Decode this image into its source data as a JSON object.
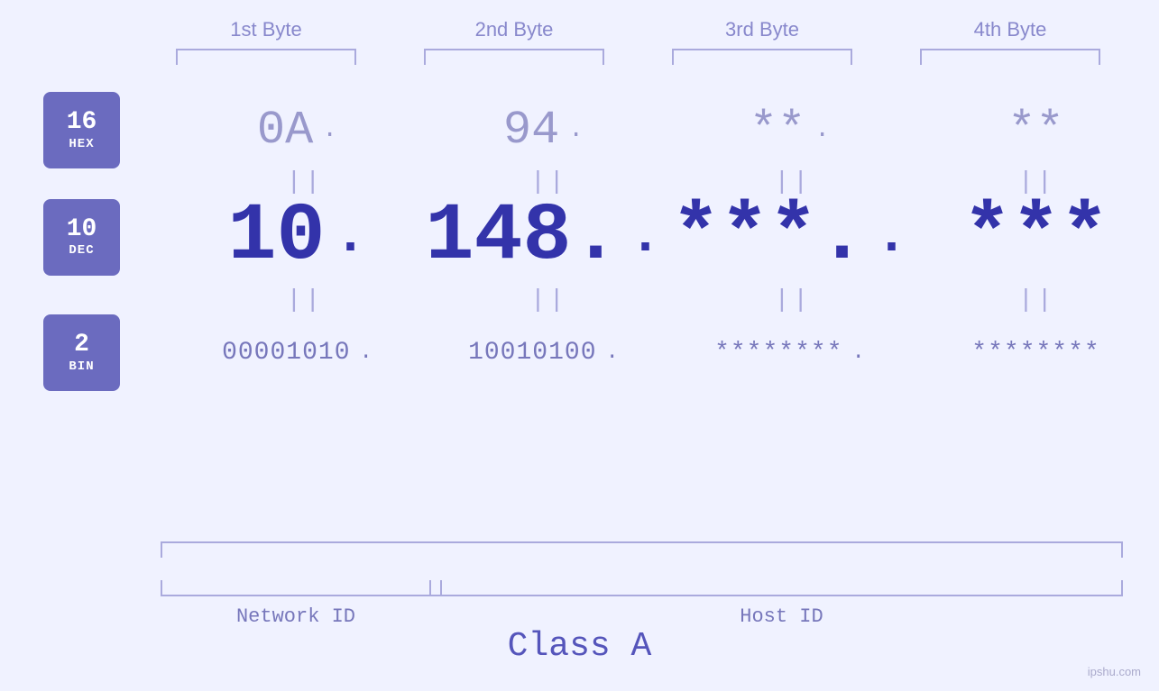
{
  "page": {
    "background": "#f0f2ff",
    "watermark": "ipshu.com"
  },
  "byteHeaders": [
    "1st Byte",
    "2nd Byte",
    "3rd Byte",
    "4th Byte"
  ],
  "rows": {
    "hex": {
      "badge": {
        "number": "16",
        "label": "HEX"
      },
      "values": [
        "0A",
        "94",
        "**",
        "**"
      ],
      "dots": [
        ".",
        ".",
        ".",
        ""
      ]
    },
    "dec": {
      "badge": {
        "number": "10",
        "label": "DEC"
      },
      "values": [
        "10",
        "148.",
        "***.",
        "***"
      ],
      "dots": [
        ".",
        ".",
        ".",
        ""
      ]
    },
    "bin": {
      "badge": {
        "number": "2",
        "label": "BIN"
      },
      "values": [
        "00001010",
        "10010100",
        "********",
        "********"
      ],
      "dots": [
        ".",
        ".",
        ".",
        ""
      ]
    }
  },
  "labels": {
    "networkID": "Network ID",
    "hostID": "Host ID",
    "classA": "Class A"
  },
  "equals": "||"
}
